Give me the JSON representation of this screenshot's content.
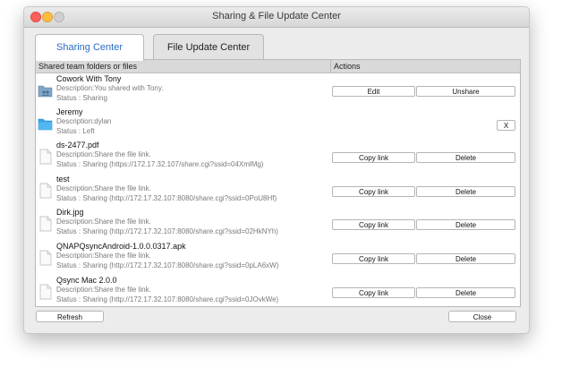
{
  "window": {
    "title": "Sharing & File Update Center"
  },
  "tabs": [
    {
      "label": "Sharing Center",
      "active": true
    },
    {
      "label": "File Update Center",
      "active": false
    }
  ],
  "table": {
    "col_files": "Shared team folders or files",
    "col_actions": "Actions"
  },
  "rows": [
    {
      "icon": "shared-folder-icon",
      "title": "Cowork With Tony",
      "description": "Description:You shared with Tony.",
      "status": "Status : Sharing",
      "actions": [
        "Edit",
        "Unshare"
      ]
    },
    {
      "icon": "folder-icon",
      "title": "Jeremy",
      "description": "Description:dylan",
      "status": "Status : Left",
      "actions": [
        "X"
      ]
    },
    {
      "icon": "file-icon",
      "title": "ds-2477.pdf",
      "description": "Description:Share the file link.",
      "status": "Status : Sharing (https://172.17.32.107/share.cgi?ssid=04XmlMg)",
      "actions": [
        "Copy link",
        "Delete"
      ]
    },
    {
      "icon": "file-icon",
      "title": "test",
      "description": "Description:Share the file link.",
      "status": "Status : Sharing (http://172.17.32.107:8080/share.cgi?ssid=0PoU8Hf)",
      "actions": [
        "Copy link",
        "Delete"
      ]
    },
    {
      "icon": "file-icon",
      "title": "Dirk.jpg",
      "description": "Description:Share the file link.",
      "status": "Status : Sharing (http://172.17.32.107:8080/share.cgi?ssid=02HkNYh)",
      "actions": [
        "Copy link",
        "Delete"
      ]
    },
    {
      "icon": "file-icon",
      "title": "QNAPQsyncAndroid-1.0.0.0317.apk",
      "description": "Description:Share the file link.",
      "status": "Status : Sharing (http://172.17.32.107:8080/share.cgi?ssid=0pLA6xW)",
      "actions": [
        "Copy link",
        "Delete"
      ]
    },
    {
      "icon": "file-icon",
      "title": "Qsync Mac 2.0.0",
      "description": "Description:Share the file link.",
      "status": "Status : Sharing (http://172.17.32.107:8080/share.cgi?ssid=0JOvkWe)",
      "actions": [
        "Copy link",
        "Delete"
      ]
    }
  ],
  "footer": {
    "refresh": "Refresh",
    "close": "Close"
  },
  "colors": {
    "accent": "#2a6cc4",
    "folder_blue": "#3aa4e6",
    "shared_folder": "#7fa6c6"
  }
}
